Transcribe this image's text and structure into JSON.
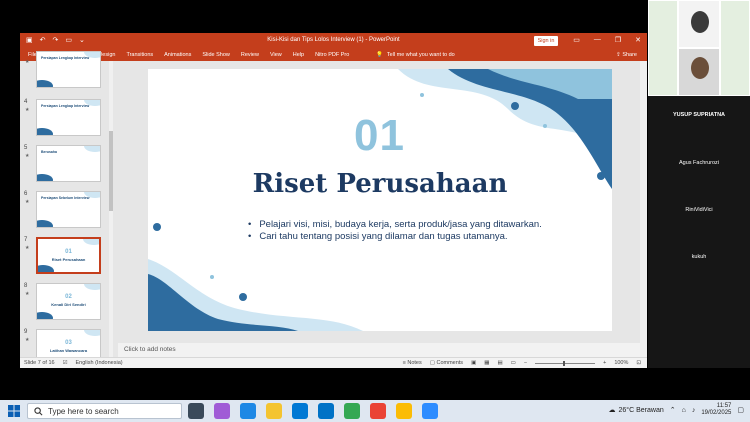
{
  "window": {
    "title": "Kisi-Kisi dan Tips Lolos Interview (1)  -  PowerPoint",
    "signin_label": "Sign in",
    "share_label": "Share",
    "tellme": "Tell me what you want to do"
  },
  "ribbon_tabs": [
    "File",
    "Home",
    "Insert",
    "Design",
    "Transitions",
    "Animations",
    "Slide Show",
    "Review",
    "View",
    "Help",
    "Nitro PDF Pro"
  ],
  "thumbnails": [
    {
      "num": "",
      "title": "Persiapan Lengkap Interview",
      "big": "",
      "mid": ""
    },
    {
      "num": "4",
      "title": "Persiapan Lengkap Interview",
      "big": "",
      "mid": ""
    },
    {
      "num": "5",
      "title": "Berusaha",
      "big": "",
      "mid": ""
    },
    {
      "num": "6",
      "title": "Persiapan Sebelum Interview",
      "big": "",
      "mid": ""
    },
    {
      "num": "7",
      "title": "",
      "big": "01",
      "mid": "Riset Perusahaan"
    },
    {
      "num": "8",
      "title": "",
      "big": "02",
      "mid": "Kenali Diri Sendiri"
    },
    {
      "num": "9",
      "title": "",
      "big": "03",
      "mid": "Latihan Wawancara"
    }
  ],
  "slide": {
    "number": "01",
    "title": "Riset Perusahaan",
    "bullets": [
      "Pelajari visi, misi, budaya kerja, serta produk/jasa yang ditawarkan.",
      "Cari tahu tentang posisi yang dilamar dan tugas utamanya."
    ]
  },
  "notes_placeholder": "Click to add notes",
  "status": {
    "slide_of": "Slide 7 of 16",
    "language": "English (Indonesia)",
    "notes_label": "Notes",
    "comments_label": "Comments",
    "zoom": "100%"
  },
  "participants": [
    "YUSUP SUPRIATNA",
    "Agus Fachrurozi",
    "RiniVidiVici",
    "kukuh"
  ],
  "taskbar": {
    "search_placeholder": "Type here to search",
    "weather": "26°C  Berawan",
    "time": "11:57",
    "date": "19/02/2025",
    "notif_count": "1"
  },
  "colors": {
    "ppt_accent": "#c43e1c",
    "slide_title": "#1d3a62",
    "slide_number": "#8fc3dd",
    "dark_blob": "#2e6c9f",
    "light_blob": "#cfe6f3"
  }
}
